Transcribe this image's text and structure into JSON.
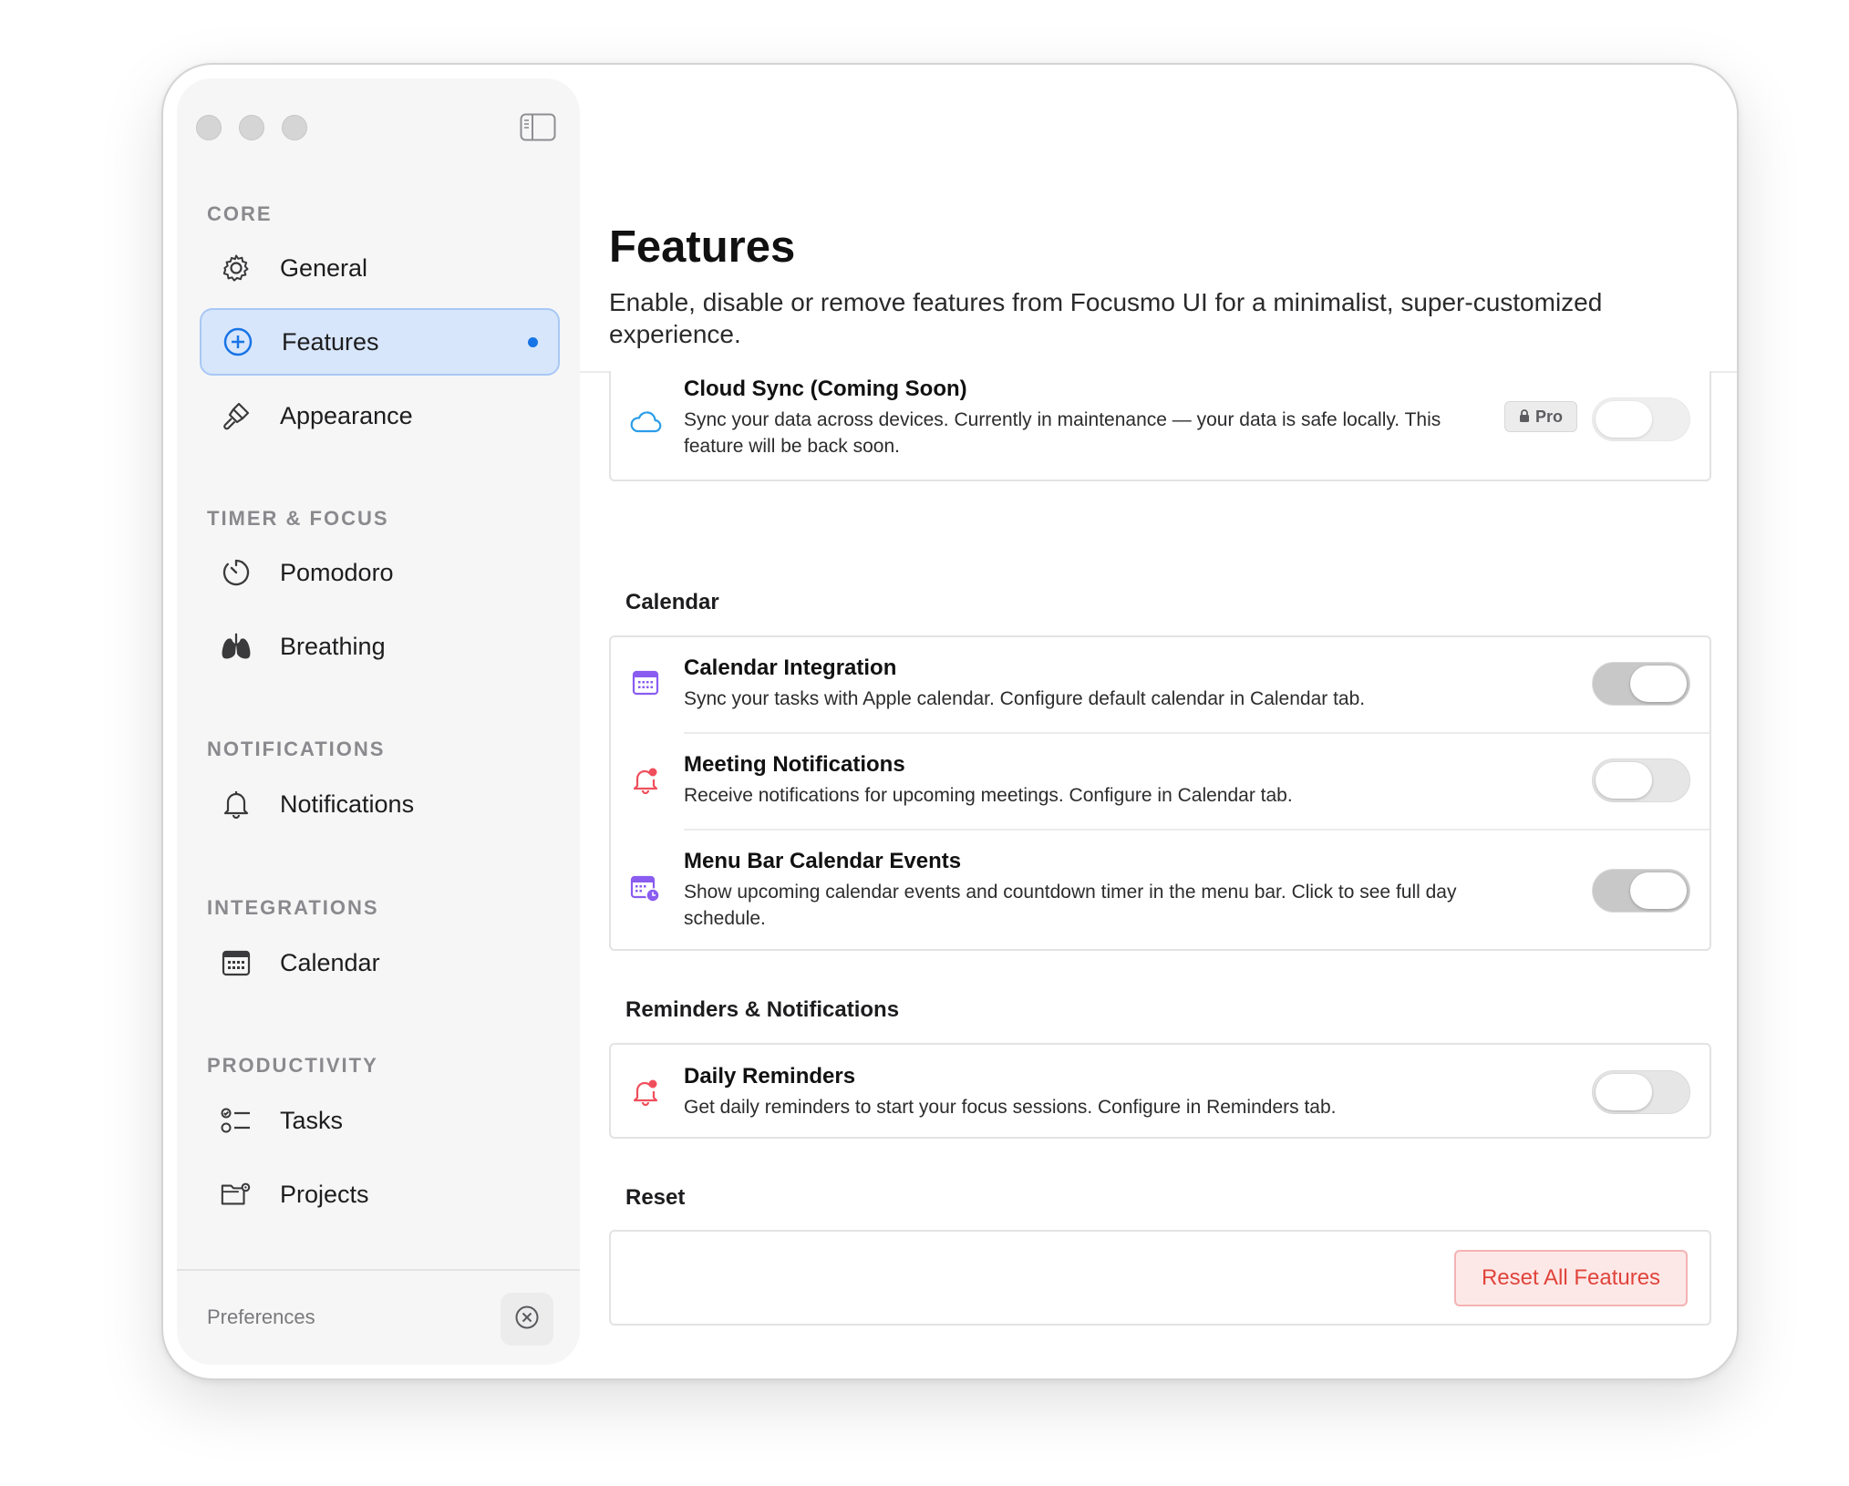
{
  "sidebar": {
    "sections": [
      {
        "title": "CORE",
        "items": [
          {
            "label": "General",
            "icon": "gear-icon"
          },
          {
            "label": "Features",
            "icon": "plus-circle-icon",
            "active": true
          },
          {
            "label": "Appearance",
            "icon": "paintbrush-icon"
          }
        ]
      },
      {
        "title": "TIMER & FOCUS",
        "items": [
          {
            "label": "Pomodoro",
            "icon": "timer-icon"
          },
          {
            "label": "Breathing",
            "icon": "lungs-icon"
          }
        ]
      },
      {
        "title": "NOTIFICATIONS",
        "items": [
          {
            "label": "Notifications",
            "icon": "bell-icon"
          }
        ]
      },
      {
        "title": "INTEGRATIONS",
        "items": [
          {
            "label": "Calendar",
            "icon": "calendar-icon"
          }
        ]
      },
      {
        "title": "PRODUCTIVITY",
        "items": [
          {
            "label": "Tasks",
            "icon": "checklist-icon"
          },
          {
            "label": "Projects",
            "icon": "folder-gear-icon"
          }
        ]
      }
    ],
    "footer_label": "Preferences"
  },
  "main": {
    "title": "Features",
    "subtitle": "Enable, disable or remove features from Focusmo UI for a minimalist, super-customized experience.",
    "cloud": {
      "title": "Cloud Sync (Coming Soon)",
      "desc": "Sync your data across devices. Currently in maintenance — your data is safe locally. This feature will be back soon.",
      "badge": "Pro",
      "enabled": false
    },
    "calendar_group": {
      "title": "Calendar",
      "items": [
        {
          "title": "Calendar Integration",
          "desc": "Sync your tasks with Apple calendar. Configure default calendar in Calendar tab.",
          "enabled": true,
          "icon": "calendar-grid-icon"
        },
        {
          "title": "Meeting Notifications",
          "desc": "Receive notifications for upcoming meetings. Configure in Calendar tab.",
          "enabled": false,
          "icon": "bell-badge-icon"
        },
        {
          "title": "Menu Bar Calendar Events",
          "desc": "Show upcoming calendar events and countdown timer in the menu bar. Click to see full day schedule.",
          "enabled": true,
          "icon": "calendar-clock-icon"
        }
      ]
    },
    "reminders_group": {
      "title": "Reminders & Notifications",
      "items": [
        {
          "title": "Daily Reminders",
          "desc": "Get daily reminders to start your focus sessions. Configure in Reminders tab.",
          "enabled": false,
          "icon": "bell-badge-icon"
        }
      ]
    },
    "reset_group": {
      "title": "Reset",
      "button": "Reset All Features"
    }
  },
  "colors": {
    "accent": "#1874e6",
    "active_bg": "#d7e6fb",
    "calendar_icon": "#8a5cf0",
    "bell_icon": "#ef4f5c",
    "cloud_icon": "#2a9de8",
    "reset_text": "#e0443a"
  }
}
